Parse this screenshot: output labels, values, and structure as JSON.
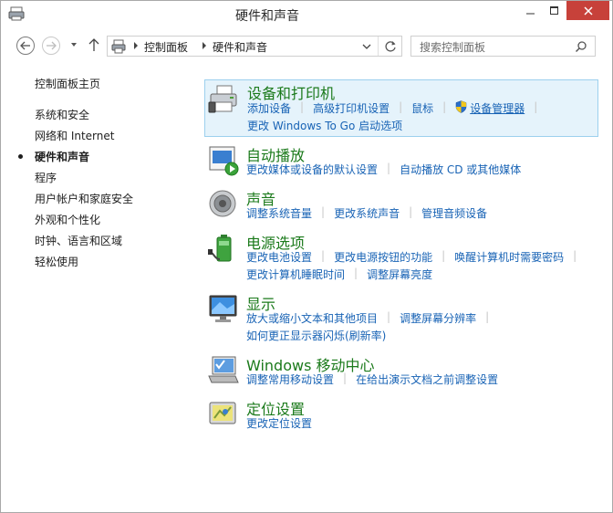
{
  "window": {
    "title": "硬件和声音"
  },
  "address": {
    "crumbs": [
      "控制面板",
      "硬件和声音"
    ],
    "search_placeholder": "搜索控制面板"
  },
  "leftnav": {
    "items": [
      {
        "label": "控制面板主页"
      },
      {
        "label": "系统和安全"
      },
      {
        "label": "网络和 Internet"
      },
      {
        "label": "硬件和声音",
        "current": true
      },
      {
        "label": "程序"
      },
      {
        "label": "用户帐户和家庭安全"
      },
      {
        "label": "外观和个性化"
      },
      {
        "label": "时钟、语言和区域"
      },
      {
        "label": "轻松使用"
      }
    ]
  },
  "categories": [
    {
      "title": "设备和打印机",
      "icon": "printer-icon",
      "rows": [
        [
          "添加设备",
          "高级打印机设置",
          "鼠标",
          "设备管理器"
        ],
        [
          "更改 Windows To Go 启动选项"
        ]
      ]
    },
    {
      "title": "自动播放",
      "icon": "autoplay-icon",
      "rows": [
        [
          "更改媒体或设备的默认设置",
          "自动播放 CD 或其他媒体"
        ]
      ]
    },
    {
      "title": "声音",
      "icon": "speaker-icon",
      "rows": [
        [
          "调整系统音量",
          "更改系统声音",
          "管理音频设备"
        ]
      ]
    },
    {
      "title": "电源选项",
      "icon": "battery-icon",
      "rows": [
        [
          "更改电池设置",
          "更改电源按钮的功能",
          "唤醒计算机时需要密码"
        ],
        [
          "更改计算机睡眠时间",
          "调整屏幕亮度"
        ]
      ]
    },
    {
      "title": "显示",
      "icon": "monitor-icon",
      "rows": [
        [
          "放大或缩小文本和其他项目",
          "调整屏幕分辨率"
        ],
        [
          "如何更正显示器闪烁(刷新率)"
        ]
      ]
    },
    {
      "title": "Windows 移动中心",
      "icon": "mobility-center-icon",
      "rows": [
        [
          "调整常用移动设置",
          "在给出演示文档之前调整设置"
        ]
      ]
    },
    {
      "title": "定位设置",
      "icon": "location-icon",
      "rows": [
        [
          "更改定位设置"
        ]
      ]
    }
  ],
  "colors": {
    "link": "#1863b5",
    "category_title": "#1b7a1b",
    "highlight_bg": "#e5f3fb",
    "highlight_border": "#9cd0ee",
    "close_button": "#c7413a"
  }
}
